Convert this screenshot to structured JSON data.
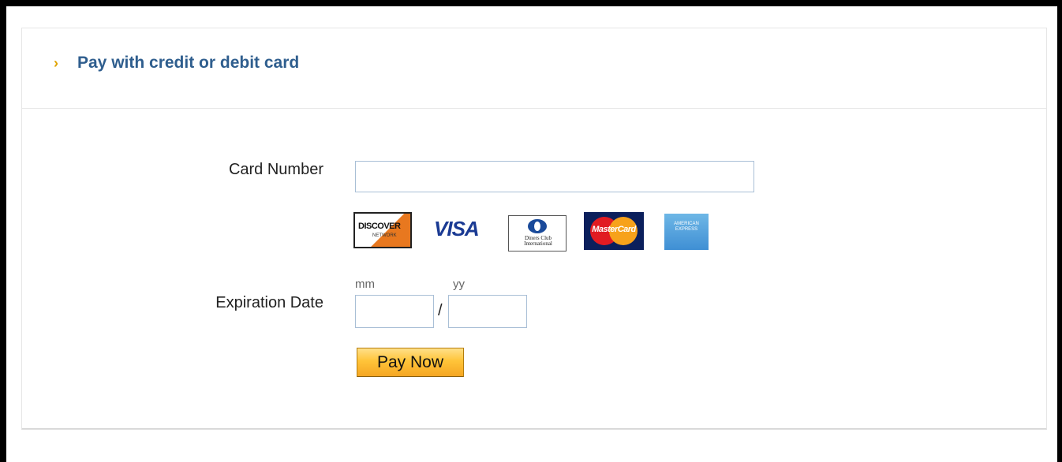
{
  "header": {
    "chevron": "›",
    "title": "Pay with credit or debit card"
  },
  "form": {
    "card_number_label": "Card Number",
    "card_number_value": "",
    "expiration_label": "Expiration Date",
    "mm_label": "mm",
    "yy_label": "yy",
    "mm_value": "",
    "yy_value": "",
    "separator": "/",
    "submit_label": "Pay Now"
  },
  "card_logos": {
    "discover": "DISCOVER",
    "discover_sub": "NETWORK",
    "visa": "VISA",
    "diners": "Diners Club International",
    "mastercard": "MasterCard",
    "amex": "AMERICAN EXPRESS"
  },
  "colors": {
    "header_title": "#2f5e8e",
    "chevron": "#e0a400",
    "input_border": "#a9bfd6",
    "button_top": "#ffe08a",
    "button_bottom": "#f5a623"
  }
}
